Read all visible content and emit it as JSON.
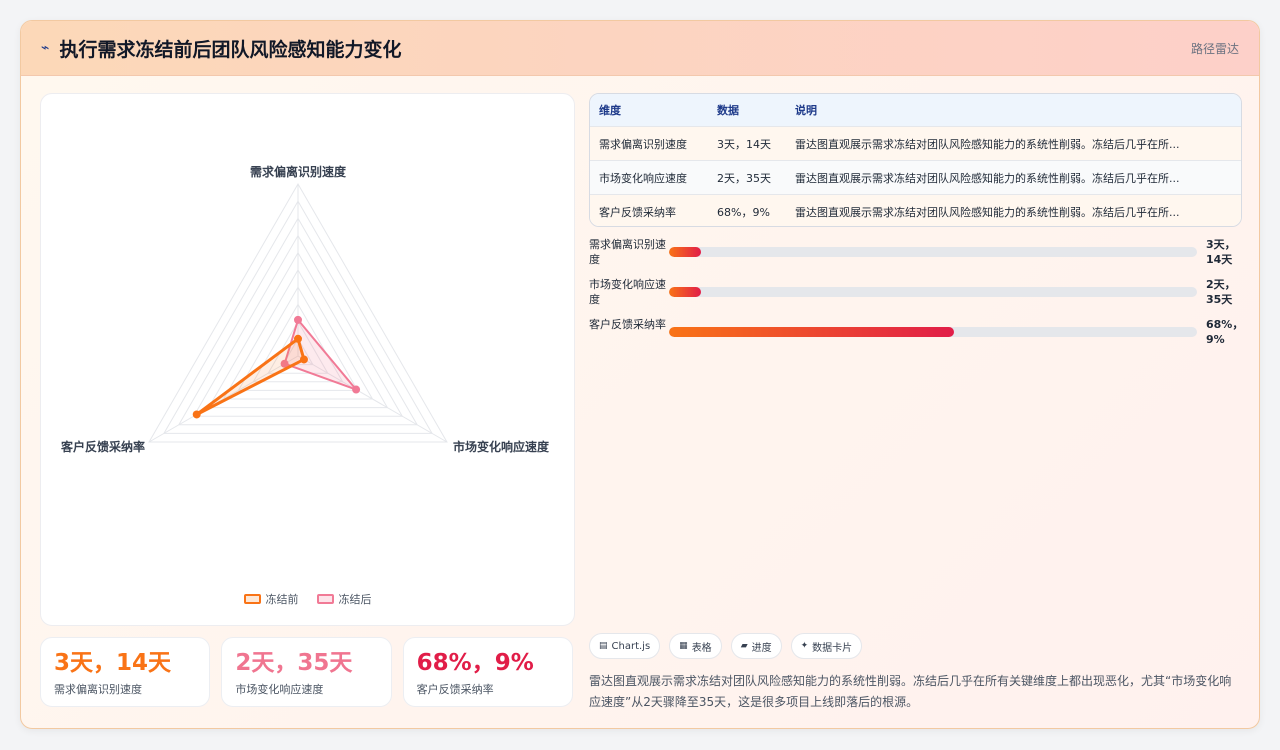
{
  "header": {
    "icon": "pulse-icon",
    "title": "执行需求冻结前后团队风险感知能力变化",
    "subtitle": "路径雷达"
  },
  "chart_data": {
    "type": "radar",
    "axes": [
      "需求偏离识别速度",
      "市场变化响应速度",
      "客户反馈采纳率"
    ],
    "scale": [
      0,
      100
    ],
    "series": [
      {
        "name": "冻结前",
        "color": "#f97316",
        "values": [
          10,
          4,
          68
        ]
      },
      {
        "name": "冻结后",
        "color": "#f17a96",
        "values": [
          21,
          39,
          9
        ]
      }
    ],
    "legend_position": "bottom"
  },
  "stats": [
    {
      "value": "3天，14天",
      "label": "需求偏离识别速度",
      "color": "#f97316"
    },
    {
      "value": "2天，35天",
      "label": "市场变化响应速度",
      "color": "#f07590"
    },
    {
      "value": "68%，9%",
      "label": "客户反馈采纳率",
      "color": "#e11d48"
    }
  ],
  "table": {
    "headers": [
      "维度",
      "数据",
      "说明"
    ],
    "rows": [
      [
        "需求偏离识别速度",
        "3天，14天",
        "雷达图直观展示需求冻结对团队风险感知能力的系统性削弱。冻结后几乎在所..."
      ],
      [
        "市场变化响应速度",
        "2天，35天",
        "雷达图直观展示需求冻结对团队风险感知能力的系统性削弱。冻结后几乎在所..."
      ],
      [
        "客户反馈采纳率",
        "68%，9%",
        "雷达图直观展示需求冻结对团队风险感知能力的系统性削弱。冻结后几乎在所..."
      ]
    ]
  },
  "bars": [
    {
      "label": "需求偏离识别速度",
      "value": "3天，14天",
      "fraction": 0.06
    },
    {
      "label": "市场变化响应速度",
      "value": "2天，35天",
      "fraction": 0.06
    },
    {
      "label": "客户反馈采纳率",
      "value": "68%，9%",
      "fraction": 0.54
    }
  ],
  "chips": [
    {
      "icon": "chart-icon",
      "label": "Chart.js"
    },
    {
      "icon": "table-icon",
      "label": "表格"
    },
    {
      "icon": "progress-icon",
      "label": "进度"
    },
    {
      "icon": "sparkle-icon",
      "label": "数据卡片"
    }
  ],
  "summary": "雷达图直观展示需求冻结对团队风险感知能力的系统性削弱。冻结后几乎在所有关键维度上都出现恶化，尤其“市场变化响应速度”从2天骤降至35天，这是很多项目上线即落后的根源。"
}
